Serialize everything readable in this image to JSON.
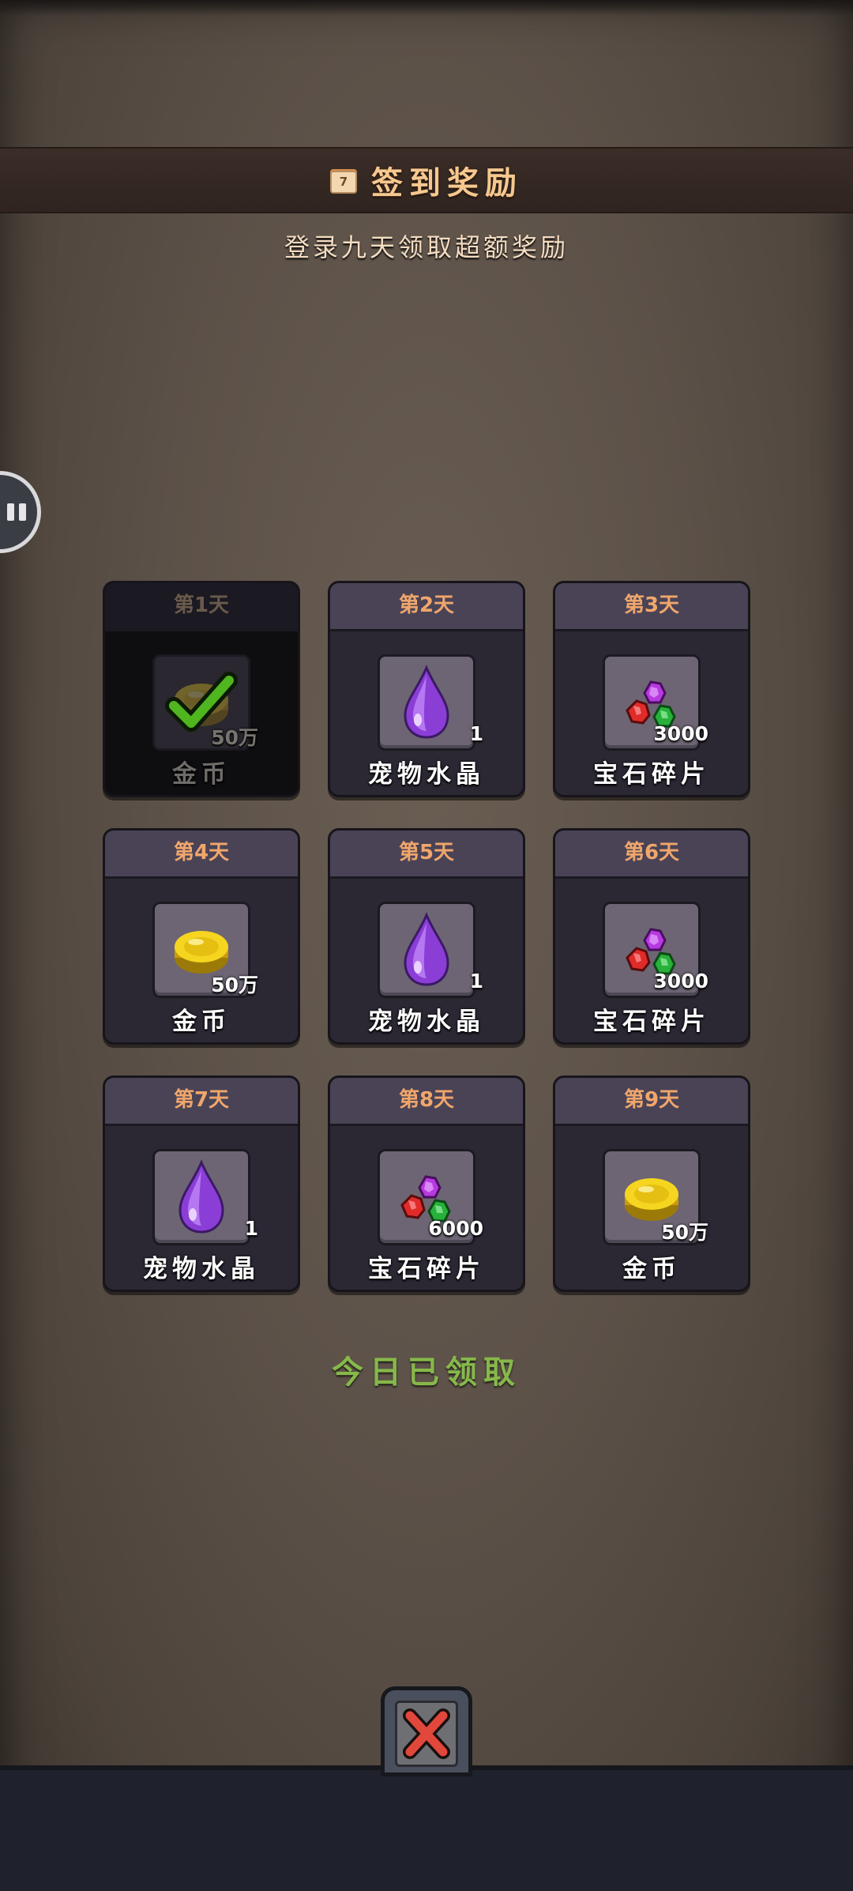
{
  "header": {
    "title": "签到奖励",
    "calendar_day": "7"
  },
  "subtitle": "登录九天领取超额奖励",
  "status_text": "今日已领取",
  "days": [
    {
      "label": "第1天",
      "item": "金币",
      "qty": "50万",
      "icon": "gold-coin-icon",
      "claimed": true
    },
    {
      "label": "第2天",
      "item": "宠物水晶",
      "qty": "1",
      "icon": "pet-crystal-icon",
      "claimed": false
    },
    {
      "label": "第3天",
      "item": "宝石碎片",
      "qty": "3000",
      "icon": "gem-shards-icon",
      "claimed": false
    },
    {
      "label": "第4天",
      "item": "金币",
      "qty": "50万",
      "icon": "gold-coin-icon",
      "claimed": false
    },
    {
      "label": "第5天",
      "item": "宠物水晶",
      "qty": "1",
      "icon": "pet-crystal-icon",
      "claimed": false
    },
    {
      "label": "第6天",
      "item": "宝石碎片",
      "qty": "3000",
      "icon": "gem-shards-icon",
      "claimed": false
    },
    {
      "label": "第7天",
      "item": "宠物水晶",
      "qty": "1",
      "icon": "pet-crystal-icon",
      "claimed": false
    },
    {
      "label": "第8天",
      "item": "宝石碎片",
      "qty": "6000",
      "icon": "gem-shards-icon",
      "claimed": false
    },
    {
      "label": "第9天",
      "item": "金币",
      "qty": "50万",
      "icon": "gold-coin-icon",
      "claimed": false
    }
  ],
  "colors": {
    "day_label": "#f0a66b",
    "status_green": "#86b84a",
    "title_orange": "#f6c88f"
  }
}
